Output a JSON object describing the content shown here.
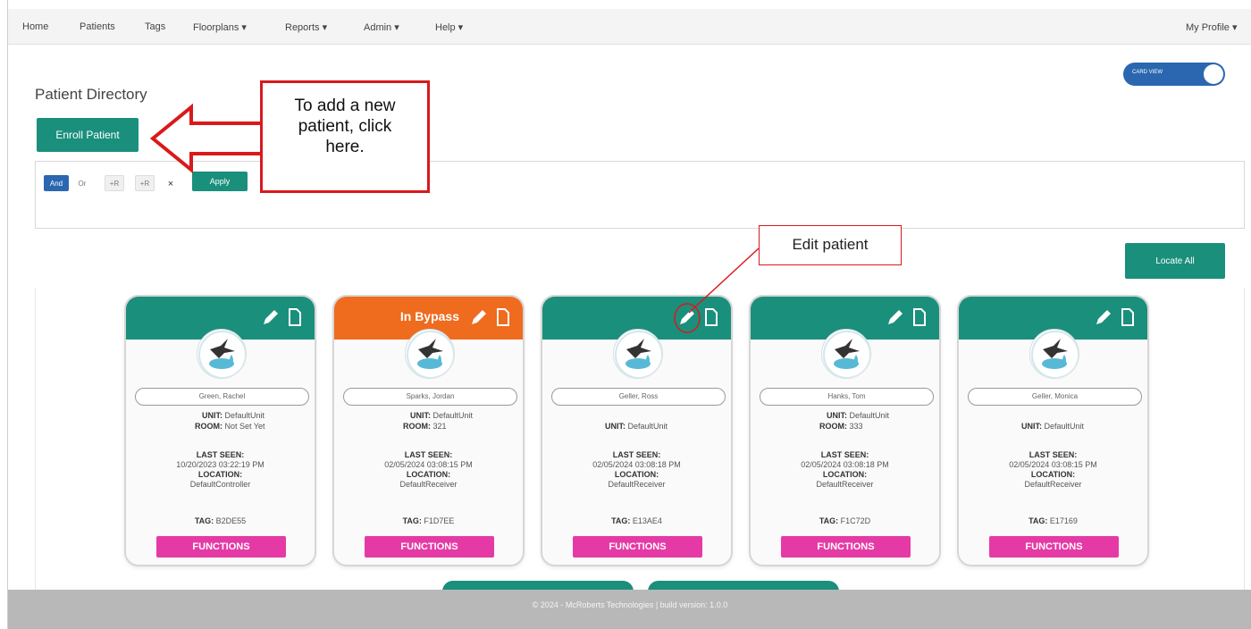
{
  "nav": {
    "items": [
      "Home",
      "Patients",
      "Tags",
      "Floorplans ▾",
      "Reports ▾",
      "Admin ▾",
      "Help ▾"
    ],
    "profile": "My Profile ▾"
  },
  "page": {
    "title": "Patient Directory",
    "enroll_label": "Enroll Patient",
    "view_toggle_label": "CARD VIEW",
    "locate_all_label": "Locate All"
  },
  "filter": {
    "chips": [
      "And",
      "Or",
      "+R",
      "+R",
      "×"
    ],
    "apply_label": "Apply"
  },
  "annotations": {
    "add_patient": "To add a new patient, click here.",
    "add_patient_lines": [
      "To add a new",
      "patient, click",
      "here."
    ],
    "edit_patient": "Edit patient"
  },
  "colors": {
    "teal": "#1a8f7c",
    "orange": "#ef6b1e",
    "pink": "#e53aa6",
    "blue": "#2a67b0",
    "callout_red": "#d9191c"
  },
  "cards": [
    {
      "name": "Green, Rachel",
      "status": "",
      "unit_label": "UNIT:",
      "unit": "DefaultUnit",
      "room_label": "ROOM:",
      "room": "Not Set Yet",
      "last_seen_label": "LAST SEEN:",
      "last_seen": "10/20/2023 03:22:19 PM",
      "location_label": "LOCATION:",
      "location": "DefaultController",
      "tag_label": "TAG:",
      "tag": "B2DE55",
      "functions_label": "FUNCTIONS"
    },
    {
      "name": "Sparks, Jordan",
      "status": "In Bypass",
      "unit_label": "UNIT:",
      "unit": "DefaultUnit",
      "room_label": "ROOM:",
      "room": "321",
      "last_seen_label": "LAST SEEN:",
      "last_seen": "02/05/2024 03:08:15 PM",
      "location_label": "LOCATION:",
      "location": "DefaultReceiver",
      "tag_label": "TAG:",
      "tag": "F1D7EE",
      "functions_label": "FUNCTIONS"
    },
    {
      "name": "Geller, Ross",
      "status": "",
      "unit_label": "UNIT:",
      "unit": "DefaultUnit",
      "room_label": "",
      "room": "",
      "last_seen_label": "LAST SEEN:",
      "last_seen": "02/05/2024 03:08:18 PM",
      "location_label": "LOCATION:",
      "location": "DefaultReceiver",
      "tag_label": "TAG:",
      "tag": "E13AE4",
      "functions_label": "FUNCTIONS"
    },
    {
      "name": "Hanks, Tom",
      "status": "",
      "unit_label": "UNIT:",
      "unit": "DefaultUnit",
      "room_label": "ROOM:",
      "room": "333",
      "last_seen_label": "LAST SEEN:",
      "last_seen": "02/05/2024 03:08:18 PM",
      "location_label": "LOCATION:",
      "location": "DefaultReceiver",
      "tag_label": "TAG:",
      "tag": "F1C72D",
      "functions_label": "FUNCTIONS"
    },
    {
      "name": "Geller, Monica",
      "status": "",
      "unit_label": "UNIT:",
      "unit": "DefaultUnit",
      "room_label": "",
      "room": "",
      "last_seen_label": "LAST SEEN:",
      "last_seen": "02/05/2024 03:08:15 PM",
      "location_label": "LOCATION:",
      "location": "DefaultReceiver",
      "tag_label": "TAG:",
      "tag": "E17169",
      "functions_label": "FUNCTIONS"
    }
  ],
  "footer": {
    "text": "© 2024 - McRoberts Technologies | build version: 1.0.0"
  }
}
